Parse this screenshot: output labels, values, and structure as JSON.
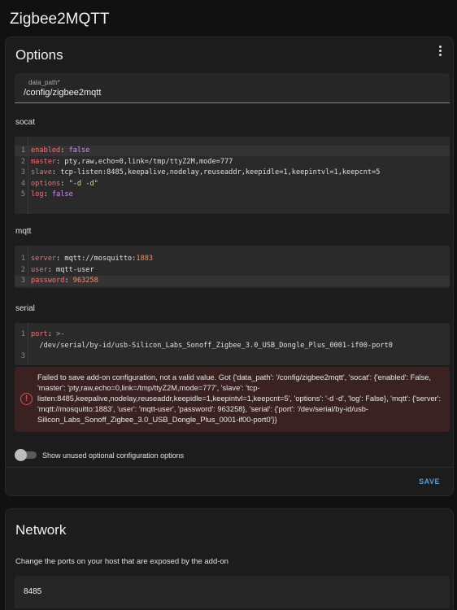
{
  "page": {
    "title": "Zigbee2MQTT"
  },
  "options_card": {
    "title": "Options",
    "menu_icon": "dots-vertical-icon",
    "data_path": {
      "label": "data_path*",
      "value": "/config/zigbee2mqtt"
    },
    "socat": {
      "label": "socat",
      "lines": [
        {
          "num": "1",
          "parts": [
            {
              "c": "k",
              "t": "enabled"
            },
            {
              "c": "t",
              "t": ": "
            },
            {
              "c": "b",
              "t": "false"
            }
          ]
        },
        {
          "num": "2",
          "parts": [
            {
              "c": "k",
              "t": "master"
            },
            {
              "c": "t",
              "t": ": pty,raw,echo=0,link=/tmp/ttyZ2M,mode=777"
            }
          ]
        },
        {
          "num": "3",
          "parts": [
            {
              "c": "k",
              "t": "slave"
            },
            {
              "c": "t",
              "t": ": tcp-listen:8485,keepalive,nodelay,reuseaddr,keepidle=1,keepintvl=1,keepcnt=5"
            }
          ]
        },
        {
          "num": "4",
          "parts": [
            {
              "c": "k",
              "t": "options"
            },
            {
              "c": "t",
              "t": ": "
            },
            {
              "c": "s",
              "t": "\"-d -d\""
            }
          ]
        },
        {
          "num": "5",
          "parts": [
            {
              "c": "k",
              "t": "log"
            },
            {
              "c": "t",
              "t": ": "
            },
            {
              "c": "b",
              "t": "false"
            }
          ]
        }
      ]
    },
    "mqtt": {
      "label": "mqtt",
      "lines": [
        {
          "num": "1",
          "parts": [
            {
              "c": "k",
              "t": "server"
            },
            {
              "c": "t",
              "t": ": mqtt://mosquitto:"
            },
            {
              "c": "n",
              "t": "1883"
            }
          ]
        },
        {
          "num": "2",
          "parts": [
            {
              "c": "k",
              "t": "user"
            },
            {
              "c": "t",
              "t": ": mqtt-user"
            }
          ]
        },
        {
          "num": "3",
          "parts": [
            {
              "c": "k",
              "t": "password"
            },
            {
              "c": "t",
              "t": ": "
            },
            {
              "c": "n",
              "t": "963258"
            }
          ]
        }
      ]
    },
    "serial": {
      "label": "serial",
      "lines": [
        {
          "num": "1",
          "parts": [
            {
              "c": "k",
              "t": "port"
            },
            {
              "c": "t",
              "t": ": "
            },
            {
              "c": "b",
              "t": ">-"
            }
          ]
        },
        {
          "num": "",
          "parts": [
            {
              "c": "t",
              "t": "  /dev/serial/by-id/usb-Silicon_Labs_Sonoff_Zigbee_3.0_USB_Dongle_Plus_0001-if00-port0"
            }
          ]
        },
        {
          "num": "3",
          "parts": [
            {
              "c": "t",
              "t": ""
            }
          ]
        }
      ]
    },
    "error": {
      "icon": "alert-circle-icon",
      "text": "Failed to save add-on configuration, not a valid value. Got {'data_path': '/config/zigbee2mqtt', 'socat': {'enabled': False, 'master': 'pty,raw,echo=0,link=/tmp/ttyZ2M,mode=777', 'slave': 'tcp-listen:8485,keepalive,nodelay,reuseaddr,keepidle=1,keepintvl=1,keepcnt=5', 'options': '-d -d', 'log': False}, 'mqtt': {'server': 'mqtt://mosquitto:1883', 'user': 'mqtt-user', 'password': 963258}, 'serial': {'port': '/dev/serial/by-id/usb-Silicon_Labs_Sonoff_Zigbee_3.0_USB_Dongle_Plus_0001-if00-port0'}}"
    },
    "toggle_label": "Show unused optional configuration options",
    "save_label": "SAVE"
  },
  "network_card": {
    "title": "Network",
    "description": "Change the ports on your host that are exposed by the add-on",
    "port_value": "8485"
  }
}
